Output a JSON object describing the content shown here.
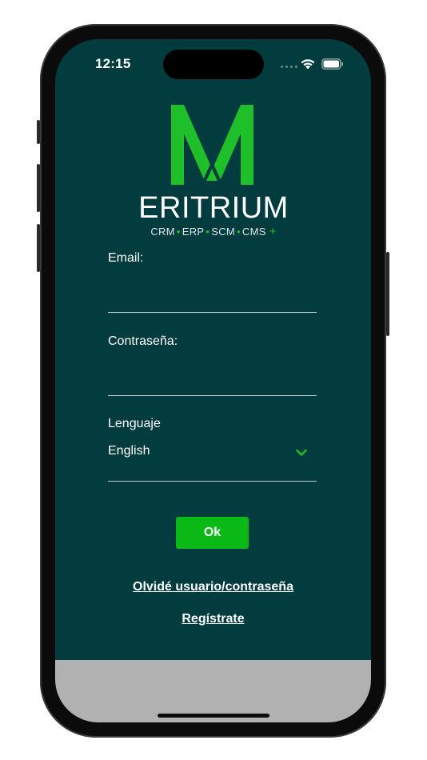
{
  "status_bar": {
    "time": "12:15"
  },
  "logo": {
    "wordmark": "ERITRIUM",
    "tagline_items": [
      "CRM",
      "ERP",
      "SCM",
      "CMS"
    ],
    "tagline_plus": "+",
    "brand_green": "#1fbf2a"
  },
  "form": {
    "email_label": "Email:",
    "email_value": "",
    "password_label": "Contraseña:",
    "password_value": "",
    "language_label": "Lenguaje",
    "language_value": "English"
  },
  "actions": {
    "ok_label": "Ok",
    "forgot_label": "Olvidé usuario/contraseña",
    "register_label": "Regístrate"
  },
  "colors": {
    "background": "#023c3e",
    "accent": "#0ab916",
    "bottom_bar": "#b1b1b1"
  },
  "icons": [
    "wifi-icon",
    "battery-icon",
    "chevron-down-icon",
    "signal-icon"
  ]
}
